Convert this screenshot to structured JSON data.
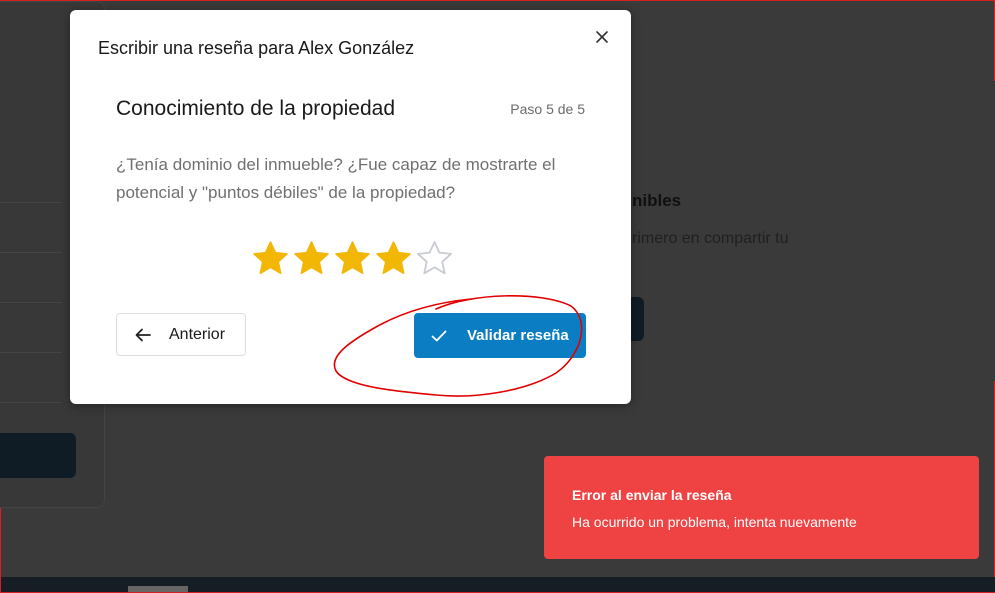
{
  "background": {
    "heading_partial": "nibles",
    "text_partial": "rimero en compartir tu"
  },
  "modal": {
    "title": "Escribir una reseña para Alex González",
    "close_icon": "close-icon",
    "step_title": "Conocimiento de la propiedad",
    "step_counter": "Paso 5 de 5",
    "question": "¿Tenía dominio del inmueble? ¿Fue capaz de mostrarte el potencial y \"puntos débiles\" de la propiedad?",
    "rating": {
      "value": 4,
      "max": 5,
      "filled_color": "#f2b705",
      "empty_color": "#c8ccd2"
    },
    "prev_button": {
      "label": "Anterior",
      "icon": "arrow-left-icon"
    },
    "validate_button": {
      "label": "Validar reseña",
      "icon": "check-icon",
      "color": "#0b7ec3"
    }
  },
  "toast": {
    "title": "Error al enviar la reseña",
    "message": "Ha ocurrido un problema, intenta nuevamente",
    "color": "#ef4242"
  },
  "annotation": {
    "color": "#e00000"
  }
}
